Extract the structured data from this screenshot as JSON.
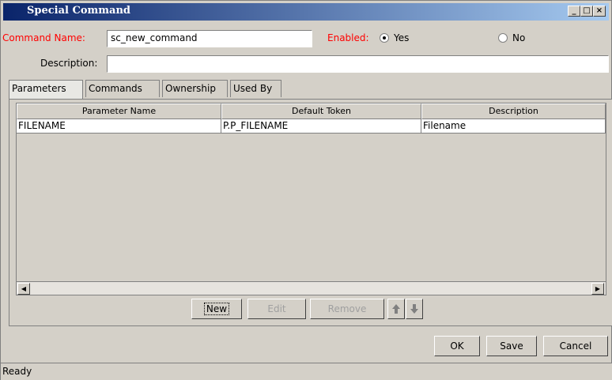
{
  "window": {
    "title": "Special Command",
    "controls": [
      "_",
      "□",
      "×"
    ]
  },
  "form": {
    "command_name_label": "Command Name:",
    "command_name_value": "sc_new_command",
    "enabled_label": "Enabled:",
    "yes_label": "Yes",
    "no_label": "No",
    "enabled_value": "Yes",
    "description_label": "Description:",
    "description_value": ""
  },
  "tabs": [
    {
      "label": "Parameters",
      "active": true
    },
    {
      "label": "Commands",
      "active": false
    },
    {
      "label": "Ownership",
      "active": false
    },
    {
      "label": "Used By",
      "active": false
    }
  ],
  "table": {
    "columns": [
      "Parameter Name",
      "Default Token",
      "Description"
    ],
    "rows": [
      [
        "FILENAME",
        "P.P_FILENAME",
        "Filename"
      ]
    ]
  },
  "table_buttons": {
    "new": "New",
    "edit": "Edit",
    "remove": "Remove"
  },
  "dialog_buttons": {
    "ok": "OK",
    "save": "Save",
    "cancel": "Cancel"
  },
  "status": "Ready",
  "colors": {
    "title_start": "#0a246a",
    "title_end": "#a6caf0",
    "label_red": "#ff0000",
    "face": "#d4d0c8"
  }
}
